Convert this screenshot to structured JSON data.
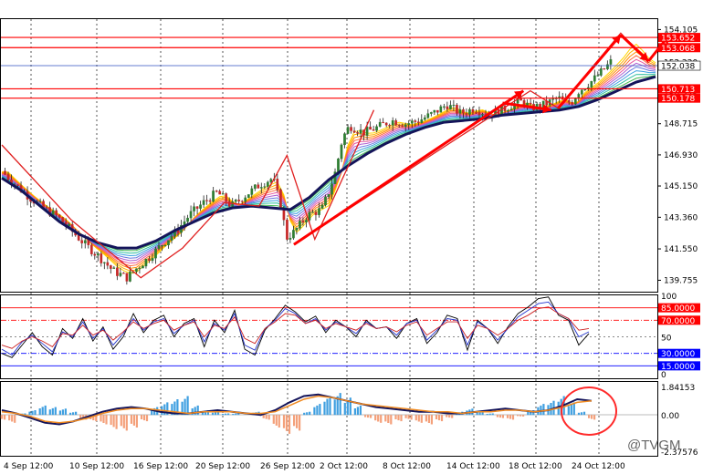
{
  "chart_data": [
    {
      "type": "candlestick",
      "panel": "price",
      "price_axis": {
        "ticks": [
          "154.105",
          "152.220",
          "150.375",
          "148.715",
          "146.930",
          "145.150",
          "143.360",
          "141.550",
          "139.755"
        ]
      },
      "price_labels": [
        {
          "text": "153.652",
          "value": 153.652,
          "color": "#ff0000"
        },
        {
          "text": "153.068",
          "value": 153.068,
          "color": "#ff0000"
        },
        {
          "text": "152.038",
          "value": 152.038,
          "color": "#000000"
        },
        {
          "text": "150.713",
          "value": 150.713,
          "color": "#ff0000"
        },
        {
          "text": "150.178",
          "value": 150.178,
          "color": "#ff0000"
        }
      ],
      "ylim": [
        139.1,
        154.7
      ],
      "ma_trend": [
        [
          0,
          145.6
        ],
        [
          6,
          144.9
        ],
        [
          12,
          144.0
        ],
        [
          18,
          143.1
        ],
        [
          24,
          142.4
        ],
        [
          30,
          141.9
        ],
        [
          36,
          141.6
        ],
        [
          42,
          141.6
        ],
        [
          48,
          142.0
        ],
        [
          54,
          142.6
        ],
        [
          60,
          143.1
        ],
        [
          66,
          143.6
        ],
        [
          72,
          143.9
        ],
        [
          78,
          144.0
        ],
        [
          84,
          143.9
        ],
        [
          90,
          143.8
        ],
        [
          96,
          144.5
        ],
        [
          102,
          145.5
        ],
        [
          108,
          146.3
        ],
        [
          114,
          147.0
        ],
        [
          120,
          147.6
        ],
        [
          126,
          148.1
        ],
        [
          132,
          148.5
        ],
        [
          138,
          148.8
        ],
        [
          144,
          148.9
        ],
        [
          150,
          149.0
        ],
        [
          156,
          149.2
        ],
        [
          162,
          149.3
        ],
        [
          168,
          149.4
        ],
        [
          174,
          149.5
        ],
        [
          180,
          149.7
        ],
        [
          186,
          150.1
        ],
        [
          192,
          150.6
        ],
        [
          198,
          151.1
        ],
        [
          204,
          151.4
        ]
      ],
      "close": [
        [
          0,
          146.0
        ],
        [
          4,
          145.2
        ],
        [
          8,
          144.5
        ],
        [
          12,
          143.9
        ],
        [
          16,
          143.4
        ],
        [
          20,
          142.6
        ],
        [
          24,
          141.8
        ],
        [
          28,
          141.1
        ],
        [
          32,
          140.3
        ],
        [
          36,
          139.9
        ],
        [
          38,
          140.3
        ],
        [
          42,
          141.0
        ],
        [
          46,
          141.8
        ],
        [
          50,
          142.5
        ],
        [
          54,
          143.5
        ],
        [
          58,
          144.2
        ],
        [
          62,
          144.8
        ],
        [
          66,
          144.0
        ],
        [
          70,
          144.6
        ],
        [
          74,
          145.2
        ],
        [
          78,
          145.6
        ],
        [
          80,
          144.2
        ],
        [
          82,
          142.2
        ],
        [
          84,
          142.5
        ],
        [
          88,
          143.5
        ],
        [
          92,
          143.8
        ],
        [
          94,
          144.8
        ],
        [
          96,
          146.0
        ],
        [
          98,
          147.9
        ],
        [
          100,
          148.6
        ],
        [
          104,
          148.2
        ],
        [
          108,
          148.5
        ],
        [
          112,
          148.9
        ],
        [
          116,
          148.7
        ],
        [
          120,
          148.9
        ],
        [
          124,
          149.3
        ],
        [
          128,
          149.8
        ],
        [
          132,
          149.3
        ],
        [
          136,
          149.6
        ],
        [
          140,
          149.2
        ],
        [
          144,
          149.5
        ],
        [
          148,
          149.9
        ],
        [
          150,
          150.0
        ],
        [
          152,
          149.6
        ],
        [
          156,
          149.8
        ],
        [
          160,
          150.2
        ],
        [
          162,
          149.9
        ],
        [
          164,
          150.0
        ],
        [
          166,
          150.6
        ],
        [
          170,
          151.2
        ],
        [
          174,
          152.0
        ],
        [
          178,
          152.9
        ],
        [
          180,
          153.6
        ],
        [
          182,
          153.2
        ],
        [
          184,
          152.6
        ],
        [
          186,
          152.3
        ],
        [
          188,
          152.1
        ]
      ],
      "zigzag": [
        [
          0,
          147.5
        ],
        [
          20,
          143.2
        ],
        [
          40,
          139.9
        ],
        [
          52,
          141.6
        ],
        [
          64,
          144.2
        ],
        [
          74,
          144.0
        ],
        [
          82,
          146.9
        ],
        [
          90,
          142.1
        ],
        [
          107,
          149.5
        ]
      ],
      "zigzag2": [
        [
          84,
          141.8
        ],
        [
          152,
          150.6
        ],
        [
          160,
          149.6
        ],
        [
          178,
          153.9
        ],
        [
          186,
          152.2
        ]
      ],
      "arrows": [
        {
          "from": [
            84,
            141.8
          ],
          "to": [
            150,
            150.6
          ]
        },
        {
          "from": [
            144,
            149.9
          ],
          "to": [
            158,
            149.5
          ]
        },
        {
          "from": [
            160,
            149.6
          ],
          "to": [
            178,
            153.8
          ]
        },
        {
          "from": [
            178,
            153.8
          ],
          "to": [
            186,
            152.3
          ]
        },
        {
          "from": [
            186,
            152.3
          ],
          "to": [
            192,
            153.8
          ]
        }
      ]
    },
    {
      "type": "line",
      "panel": "oscillator",
      "axis_ticks": [
        "100",
        "50",
        "0"
      ],
      "levels": [
        {
          "text": "85.0000",
          "value": 85,
          "color": "#ff0000",
          "style": "solid"
        },
        {
          "text": "70.0000",
          "value": 70,
          "color": "#ff0000",
          "style": "dashdot"
        },
        {
          "text": "30.0000",
          "value": 30,
          "color": "#0000ff",
          "style": "dashdot"
        },
        {
          "text": "15.0000",
          "value": 15,
          "color": "#0000ff",
          "style": "solid"
        }
      ],
      "ylim": [
        0,
        100
      ],
      "series": [
        {
          "color": "#000000",
          "values": [
            30,
            25,
            40,
            55,
            38,
            28,
            60,
            48,
            72,
            45,
            62,
            35,
            50,
            78,
            55,
            70,
            76,
            50,
            66,
            72,
            38,
            70,
            55,
            82,
            35,
            28,
            58,
            72,
            88,
            80,
            68,
            75,
            55,
            70,
            62,
            50,
            70,
            60,
            62,
            48,
            66,
            72,
            42,
            55,
            76,
            72,
            34,
            70,
            60,
            42,
            62,
            78,
            86,
            96,
            98,
            76,
            70,
            40,
            54
          ]
        },
        {
          "color": "#2233cc",
          "values": [
            35,
            28,
            44,
            52,
            42,
            32,
            56,
            50,
            68,
            48,
            60,
            40,
            54,
            72,
            58,
            68,
            72,
            54,
            64,
            70,
            44,
            66,
            58,
            78,
            40,
            34,
            60,
            70,
            84,
            78,
            66,
            72,
            58,
            68,
            62,
            54,
            68,
            60,
            62,
            52,
            66,
            70,
            46,
            58,
            72,
            70,
            40,
            68,
            60,
            46,
            60,
            74,
            82,
            90,
            92,
            78,
            72,
            50,
            56
          ]
        },
        {
          "color": "#cc2222",
          "values": [
            40,
            36,
            45,
            50,
            45,
            38,
            54,
            52,
            64,
            52,
            58,
            46,
            56,
            68,
            60,
            66,
            70,
            58,
            64,
            68,
            50,
            64,
            60,
            74,
            48,
            42,
            60,
            68,
            78,
            76,
            66,
            70,
            60,
            66,
            62,
            58,
            66,
            60,
            62,
            56,
            64,
            68,
            52,
            60,
            68,
            68,
            48,
            64,
            60,
            52,
            60,
            70,
            76,
            84,
            86,
            78,
            72,
            58,
            60
          ]
        }
      ]
    },
    {
      "type": "bar",
      "panel": "histogram",
      "axis_ticks": [
        "1.84153",
        "0.00",
        "-2.37576"
      ],
      "ylim": [
        -2.6,
        2.1
      ],
      "bars": [
        -0.3,
        -0.5,
        0.1,
        0.3,
        0.6,
        0.5,
        0.4,
        0.2,
        -0.3,
        -0.4,
        -0.6,
        -0.9,
        -1.0,
        -0.8,
        -0.4,
        0.5,
        0.8,
        1.0,
        1.2,
        0.6,
        0.3,
        0.2,
        0.1,
        0.1,
        0.0,
        0.2,
        -0.3,
        -0.8,
        -1.2,
        -1.0,
        0.2,
        0.7,
        1.2,
        1.4,
        1.1,
        0.6,
        -0.2,
        -0.5,
        -0.6,
        -0.4,
        -0.3,
        -0.5,
        -0.6,
        -0.4,
        -0.2,
        0.2,
        0.4,
        0.3,
        0.1,
        -0.2,
        -0.3,
        -0.1,
        0.3,
        0.7,
        0.9,
        1.2,
        0.8,
        0.2,
        -0.3
      ],
      "line_dark": [
        0.3,
        0.1,
        -0.2,
        -0.5,
        -0.6,
        -0.4,
        -0.1,
        0.2,
        0.4,
        0.5,
        0.4,
        0.2,
        0.1,
        0.1,
        0.2,
        0.3,
        0.2,
        0.1,
        0.0,
        0.3,
        0.8,
        1.2,
        1.3,
        1.1,
        0.9,
        0.7,
        0.5,
        0.4,
        0.3,
        0.2,
        0.2,
        0.1,
        0.1,
        0.2,
        0.3,
        0.4,
        0.3,
        0.2,
        0.3,
        0.6,
        1.0,
        0.9
      ],
      "line_orange": [
        0.2,
        0.1,
        -0.1,
        -0.4,
        -0.5,
        -0.4,
        -0.2,
        0.1,
        0.3,
        0.4,
        0.4,
        0.3,
        0.2,
        0.1,
        0.2,
        0.2,
        0.2,
        0.1,
        0.1,
        0.2,
        0.6,
        1.0,
        1.2,
        1.1,
        0.9,
        0.7,
        0.6,
        0.5,
        0.4,
        0.3,
        0.2,
        0.2,
        0.1,
        0.2,
        0.2,
        0.3,
        0.3,
        0.2,
        0.3,
        0.5,
        0.8,
        0.9
      ]
    }
  ],
  "time_axis": {
    "labels": [
      "4 Sep 12:00",
      "10 Sep 12:00",
      "16 Sep 12:00",
      "20 Sep 12:00",
      "26 Sep 12:00",
      "2 Oct 12:00",
      "8 Oct 12:00",
      "14 Oct 12:00",
      "18 Oct 12:00",
      "24 Oct 12:00"
    ]
  },
  "watermark": "@TVGM",
  "colors": {
    "bull": "#2e7d32",
    "bear": "#c62828",
    "ma": "#14145a",
    "arrow": "#ff0000",
    "hist_pos": "#3f9fe0",
    "hist_neg": "#f4a07a"
  }
}
